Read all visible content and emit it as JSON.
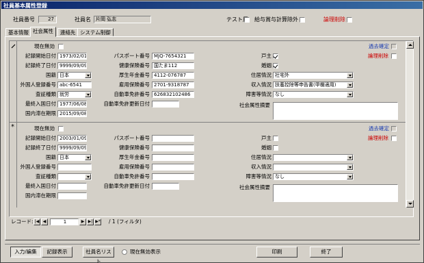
{
  "window": {
    "title": "社員基本属性登録"
  },
  "header": {
    "employee_no_label": "社員番号",
    "employee_no": "27",
    "employee_name_label": "社員名",
    "employee_name": "片岡 弘志",
    "test_label": "テスト用",
    "payroll_excl_label": "給与賞与計算除外",
    "logical_delete_label": "論理削除"
  },
  "tabs": [
    "基本情報",
    "社会属性",
    "連絡先",
    "システム制御"
  ],
  "record1": {
    "current_invalid_label": "現在無効",
    "past_confirm_label": "過去確定",
    "logical_delete_label": "論理削除",
    "rec_start_label": "記録開始日付",
    "rec_start": "1973/02/01",
    "rec_end_label": "記録終了日付",
    "rec_end": "9999/09/09",
    "nationality_label": "国籍",
    "nationality": "日本",
    "alien_reg_label": "外国人登録番号",
    "alien_reg": "abc-6541",
    "proof_type_label": "査証種類",
    "proof_type": "就労",
    "last_entry_label": "最終入国日付",
    "last_entry": "1977/06/08",
    "stay_limit_label": "国内滞在期限",
    "stay_limit": "2015/09/08",
    "passport_label": "パスポート番号",
    "passport": "MJQ-7654321",
    "health_ins_label": "健康保険番号",
    "health_ins": "国たま112",
    "pension_label": "厚生年金番号",
    "pension": "4112-076787",
    "employ_ins_label": "雇用保険番号",
    "employ_ins": "2701-9318787",
    "license_label": "自動車免許番号",
    "license": "626832102486",
    "license_renew_label": "自動車免許更新日付",
    "license_renew": "",
    "householder_label": "戸主",
    "married_label": "婚姻",
    "residence_label": "住居情況",
    "residence": "社宅外",
    "income_label": "収入情況",
    "income": "扶養控除等申告書(甲欄適用)",
    "disability_label": "障害等情況",
    "disability": "なし",
    "social_memo_label": "社会属性摘要"
  },
  "record2": {
    "current_invalid_label": "現在無効",
    "past_confirm_label": "過去確定",
    "logical_delete_label": "論理削除",
    "rec_start_label": "記録開始日付",
    "rec_start": "2003/01/09",
    "rec_end_label": "記録終了日付",
    "rec_end": "9999/09/09",
    "nationality_label": "国籍",
    "nationality": "日本",
    "alien_reg_label": "外国人登録番号",
    "alien_reg": "",
    "proof_type_label": "査証種類",
    "proof_type": "",
    "last_entry_label": "最終入国日付",
    "last_entry": "",
    "stay_limit_label": "国内滞在期限",
    "stay_limit": "",
    "passport_label": "パスポート番号",
    "passport": "",
    "health_ins_label": "健康保険番号",
    "health_ins": "",
    "pension_label": "厚生年金番号",
    "pension": "",
    "employ_ins_label": "雇用保険番号",
    "employ_ins": "",
    "license_label": "自動車免許番号",
    "license": "",
    "license_renew_label": "自動車免許更新日付",
    "license_renew": "",
    "householder_label": "戸主",
    "married_label": "婚姻",
    "residence_label": "住居情況",
    "residence": "",
    "income_label": "収入情況",
    "income": "",
    "disability_label": "障害等情況",
    "disability": "なし",
    "social_memo_label": "社会属性摘要"
  },
  "navigator": {
    "label": "レコード:",
    "current": "1",
    "total_text": "/ 1 (フィルタ)"
  },
  "footer": {
    "input_edit": "入力/編集",
    "record_view": "記録表示",
    "employee_list": "社員名リスト",
    "show_current_invalid": "現在無効表示",
    "print": "印刷",
    "close": "終了"
  }
}
